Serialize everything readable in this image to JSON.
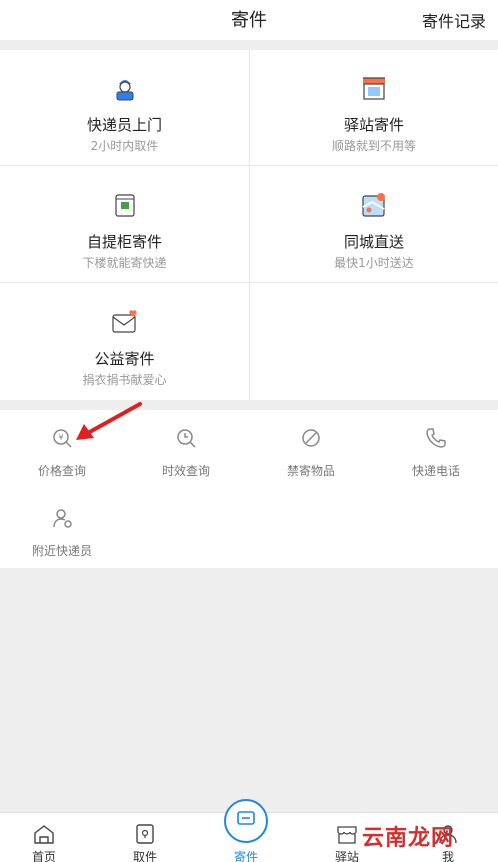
{
  "header": {
    "title": "寄件",
    "action": "寄件记录"
  },
  "services": [
    {
      "title": "快递员上门",
      "subtitle": "2小时内取件",
      "icon": "courier-icon"
    },
    {
      "title": "驿站寄件",
      "subtitle": "顺路就到不用等",
      "icon": "store-icon"
    },
    {
      "title": "自提柜寄件",
      "subtitle": "下楼就能寄快递",
      "icon": "locker-icon"
    },
    {
      "title": "同城直送",
      "subtitle": "最快1小时送达",
      "icon": "map-pin-icon"
    },
    {
      "title": "公益寄件",
      "subtitle": "捐衣捐书献爱心",
      "icon": "heart-envelope-icon"
    }
  ],
  "tools": [
    {
      "label": "价格查询",
      "icon": "price-search-icon"
    },
    {
      "label": "时效查询",
      "icon": "clock-search-icon"
    },
    {
      "label": "禁寄物品",
      "icon": "prohibited-icon"
    },
    {
      "label": "快递电话",
      "icon": "phone-icon"
    },
    {
      "label": "附近快递员",
      "icon": "nearby-courier-icon"
    }
  ],
  "tabs": [
    {
      "label": "首页",
      "icon": "home-icon"
    },
    {
      "label": "取件",
      "icon": "pickup-icon"
    },
    {
      "label": "寄件",
      "icon": "send-icon",
      "active": true
    },
    {
      "label": "驿站",
      "icon": "station-icon"
    },
    {
      "label": "我",
      "icon": "profile-icon"
    }
  ],
  "watermark": "云南龙网",
  "colors": {
    "accent": "#1e88e5",
    "annotation_arrow": "#e02020",
    "watermark": "#d32f2f"
  }
}
